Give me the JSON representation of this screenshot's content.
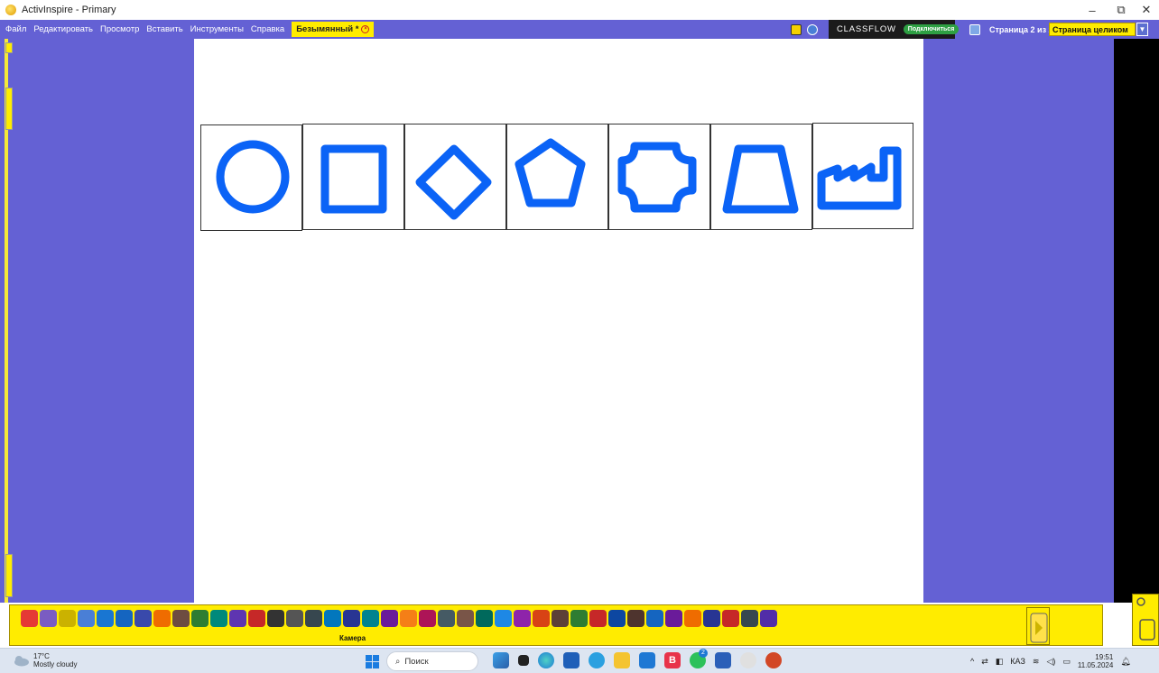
{
  "window": {
    "title": "ActivInspire - Primary",
    "controls": {
      "minimize": "–",
      "restore": "⧉",
      "close": "✕"
    }
  },
  "menu": {
    "items": [
      "Файл",
      "Редактировать",
      "Просмотр",
      "Вставить",
      "Инструменты",
      "Справка"
    ],
    "document_tab": "Безымянный *"
  },
  "classflow": {
    "brand": "CLASSFLOW",
    "connect_label": "Подключиться"
  },
  "pages": {
    "indicator": "Страница 2 из 2",
    "zoom_selected": "Страница целиком"
  },
  "canvas": {
    "shapes": [
      "circle",
      "square",
      "diamond",
      "pentagon",
      "octagon-scalloped",
      "trapezoid",
      "factory"
    ],
    "shape_color": "#0b63f6"
  },
  "toolbox": {
    "tool_label": "Камера",
    "tool_icons": [
      "pen-tool-icon",
      "select-icon",
      "marker-icon",
      "highlighter-icon",
      "pen-icon",
      "pen-2-icon",
      "pen-3-icon",
      "magic-ink-icon",
      "eraser-icon",
      "shape-icon",
      "connector-icon",
      "text-icon",
      "fill-icon",
      "stamp-icon",
      "magnify-icon",
      "camera-icon",
      "spotlight-icon",
      "triangle-icon",
      "ruler-icon",
      "protractor-icon",
      "compass-icon",
      "revealer-icon",
      "dice-icon",
      "calculator-icon",
      "clipart-icon",
      "teacher-icon",
      "grid-icon",
      "timer-icon",
      "recorder-icon",
      "web-icon",
      "spell-icon",
      "screen-keyboard-icon",
      "notes-icon",
      "clock-icon",
      "sound-icon",
      "video-icon",
      "text-box-icon",
      "page-icon",
      "misc-icon",
      "paw-icon"
    ],
    "colors": {
      "toolbar": "#ffec00",
      "background": "#6461d4"
    }
  },
  "taskbar": {
    "weather_temp": "17°C",
    "weather_desc": "Mostly cloudy",
    "search_placeholder": "Поиск",
    "language": "КАЗ",
    "time": "19:51",
    "date": "11.05.2024",
    "notification_count": "2"
  }
}
